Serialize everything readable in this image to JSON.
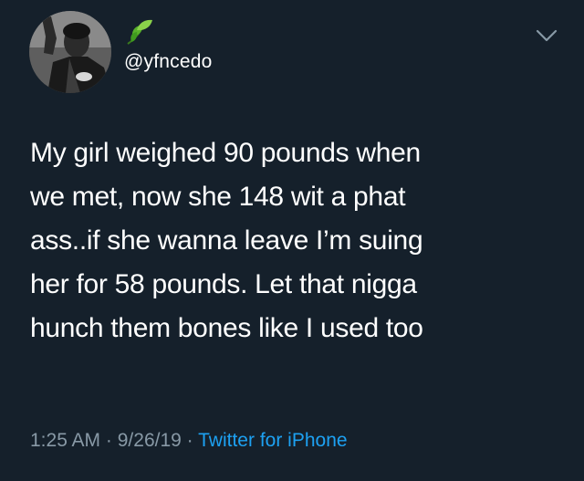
{
  "tweet": {
    "handle": "@yfncedo",
    "text": "My girl weighed 90 pounds when\nwe met, now she 148 wit a phat\nass..if she wanna leave I’m suing\nher for 58 pounds. Let that nigga\nhunch them bones like I used too",
    "time": "1:25 AM",
    "separator": "·",
    "date": "9/26/19",
    "source": "Twitter for iPhone",
    "name_emoji": "leaf-emoji",
    "menu_icon": "chevron-down-icon"
  },
  "colors": {
    "background": "#15202b",
    "text": "#ffffff",
    "meta": "#8899a6",
    "link": "#1da1f2"
  }
}
